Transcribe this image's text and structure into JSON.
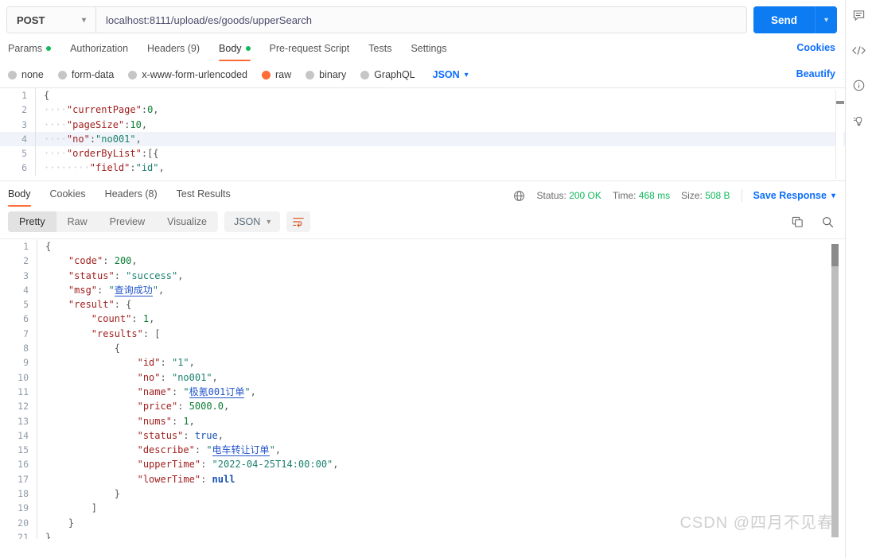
{
  "request": {
    "method": "POST",
    "url": "localhost:8111/upload/es/goods/upperSearch",
    "send_label": "Send",
    "tabs": [
      {
        "label": "Params",
        "dot": true,
        "active": false
      },
      {
        "label": "Authorization",
        "dot": false,
        "active": false
      },
      {
        "label": "Headers (9)",
        "dot": false,
        "active": false
      },
      {
        "label": "Body",
        "dot": true,
        "active": true
      },
      {
        "label": "Pre-request Script",
        "dot": false,
        "active": false
      },
      {
        "label": "Tests",
        "dot": false,
        "active": false
      },
      {
        "label": "Settings",
        "dot": false,
        "active": false
      }
    ],
    "cookies_label": "Cookies",
    "beautify_label": "Beautify",
    "body_types": [
      {
        "label": "none",
        "selected": false
      },
      {
        "label": "form-data",
        "selected": false
      },
      {
        "label": "x-www-form-urlencoded",
        "selected": false
      },
      {
        "label": "raw",
        "selected": true
      },
      {
        "label": "binary",
        "selected": false
      },
      {
        "label": "GraphQL",
        "selected": false
      }
    ],
    "raw_format": "JSON",
    "body_lines": [
      {
        "n": "1",
        "highlight": false,
        "code": "{"
      },
      {
        "n": "2",
        "highlight": false,
        "code": "····\"currentPage\":0,"
      },
      {
        "n": "3",
        "highlight": false,
        "code": "····\"pageSize\":10,"
      },
      {
        "n": "4",
        "highlight": true,
        "code": "····\"no\":\"no001\","
      },
      {
        "n": "5",
        "highlight": false,
        "code": "····\"orderByList\":[{"
      },
      {
        "n": "6",
        "highlight": false,
        "code": "········\"field\":\"id\","
      }
    ]
  },
  "response": {
    "tabs": [
      {
        "label": "Body",
        "active": true
      },
      {
        "label": "Cookies",
        "active": false
      },
      {
        "label": "Headers (8)",
        "active": false,
        "count_suffix": "(8)"
      },
      {
        "label": "Test Results",
        "active": false
      }
    ],
    "status_label": "Status:",
    "status_value": "200 OK",
    "time_label": "Time:",
    "time_value": "468 ms",
    "size_label": "Size:",
    "size_value": "508 B",
    "save_response_label": "Save Response",
    "view_modes": [
      {
        "label": "Pretty",
        "active": true
      },
      {
        "label": "Raw",
        "active": false
      },
      {
        "label": "Preview",
        "active": false
      },
      {
        "label": "Visualize",
        "active": false
      }
    ],
    "format": "JSON",
    "body_lines": [
      {
        "n": "1",
        "code": "{"
      },
      {
        "n": "2",
        "code": "    \"code\": 200,"
      },
      {
        "n": "3",
        "code": "    \"status\": \"success\","
      },
      {
        "n": "4",
        "code": "    \"msg\": \"查询成功\","
      },
      {
        "n": "5",
        "code": "    \"result\": {"
      },
      {
        "n": "6",
        "code": "        \"count\": 1,"
      },
      {
        "n": "7",
        "code": "        \"results\": ["
      },
      {
        "n": "8",
        "code": "            {"
      },
      {
        "n": "9",
        "code": "                \"id\": \"1\","
      },
      {
        "n": "10",
        "code": "                \"no\": \"no001\","
      },
      {
        "n": "11",
        "code": "                \"name\": \"极氪001订单\","
      },
      {
        "n": "12",
        "code": "                \"price\": 5000.0,"
      },
      {
        "n": "13",
        "code": "                \"nums\": 1,"
      },
      {
        "n": "14",
        "code": "                \"status\": true,"
      },
      {
        "n": "15",
        "code": "                \"describe\": \"电车转让订单\","
      },
      {
        "n": "16",
        "code": "                \"upperTime\": \"2022-04-25T14:00:00\","
      },
      {
        "n": "17",
        "code": "                \"lowerTime\": null"
      },
      {
        "n": "18",
        "code": "            }"
      },
      {
        "n": "19",
        "code": "        ]"
      },
      {
        "n": "20",
        "code": "    }"
      },
      {
        "n": "21",
        "code": "}"
      }
    ],
    "watermark": "CSDN @四月不见春"
  },
  "right_rail": [
    {
      "icon": "comment-icon"
    },
    {
      "icon": "code-icon"
    },
    {
      "icon": "info-icon"
    },
    {
      "icon": "lightbulb-icon"
    }
  ],
  "colors": {
    "accent_orange": "#ff6c37",
    "link_blue": "#0d6efd",
    "send_blue": "#0d7cf2",
    "status_green": "#11b95c"
  }
}
